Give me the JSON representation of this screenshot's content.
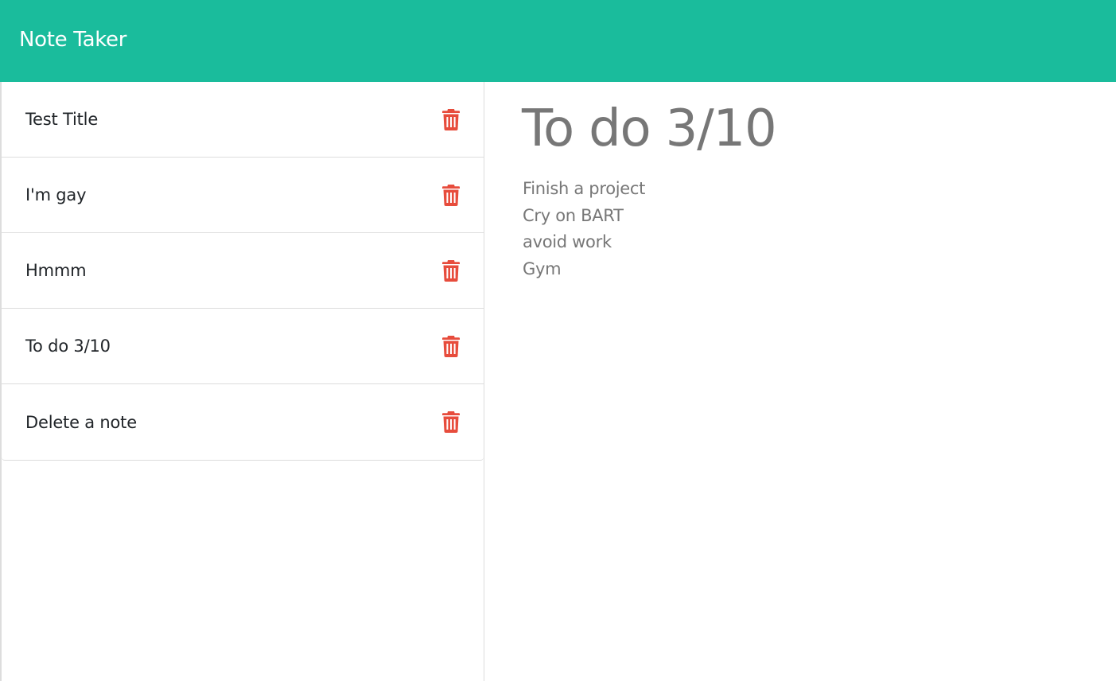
{
  "app": {
    "brand": "Note Taker",
    "accent_color": "#1abc9c",
    "delete_color": "#e74c3c"
  },
  "notes": [
    {
      "title": "Test Title",
      "delete_icon": "trash-icon"
    },
    {
      "title": "I'm gay",
      "delete_icon": "trash-icon"
    },
    {
      "title": "Hmmm",
      "delete_icon": "trash-icon"
    },
    {
      "title": "To do 3/10",
      "delete_icon": "trash-icon"
    },
    {
      "title": "Delete a note",
      "delete_icon": "trash-icon"
    }
  ],
  "active_note": {
    "title": "To do 3/10",
    "body": "Finish a project\nCry on BART\navoid work\nGym"
  }
}
